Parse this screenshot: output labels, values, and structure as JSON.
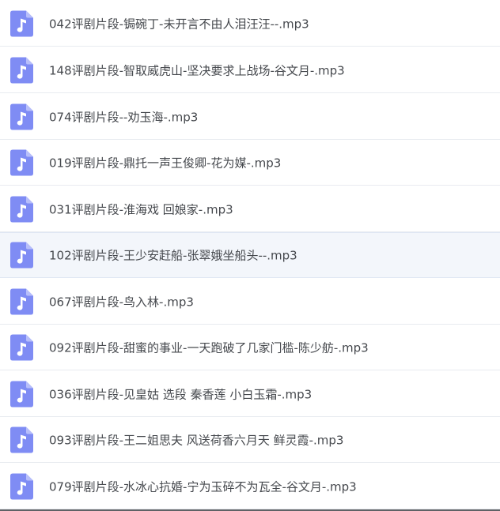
{
  "files": [
    {
      "name": "042评剧片段-锔碗丁-未开言不由人泪汪汪--.mp3",
      "icon": "audio-file-icon"
    },
    {
      "name": "148评剧片段-智取威虎山-坚决要求上战场-谷文月-.mp3",
      "icon": "audio-file-icon"
    },
    {
      "name": "074评剧片段--劝玉海-.mp3",
      "icon": "audio-file-icon"
    },
    {
      "name": "019评剧片段-鼎托一声王俊卿-花为媒-.mp3",
      "icon": "audio-file-icon"
    },
    {
      "name": "031评剧片段-淮海戏 回娘家-.mp3",
      "icon": "audio-file-icon"
    },
    {
      "name": "102评剧片段-王少安赶船-张翠娥坐船头--.mp3",
      "icon": "audio-file-icon",
      "selected": true
    },
    {
      "name": "067评剧片段-鸟入林-.mp3",
      "icon": "audio-file-icon"
    },
    {
      "name": "092评剧片段-甜蜜的事业-一天跑破了几家门槛-陈少舫-.mp3",
      "icon": "audio-file-icon"
    },
    {
      "name": "036评剧片段-见皇姑 选段 秦香莲 小白玉霜-.mp3",
      "icon": "audio-file-icon"
    },
    {
      "name": "093评剧片段-王二姐思夫 风送荷香六月天 鲜灵霞-.mp3",
      "icon": "audio-file-icon"
    },
    {
      "name": "079评剧片段-水冰心抗婚-宁为玉碎不为瓦全-谷文月-.mp3",
      "icon": "audio-file-icon"
    }
  ],
  "colors": {
    "icon_fill": "#7f8cf4",
    "icon_fold": "#b7befa",
    "text": "#45484d",
    "selected_bg": "#f3f6fb",
    "divider": "#e8ebf0"
  }
}
